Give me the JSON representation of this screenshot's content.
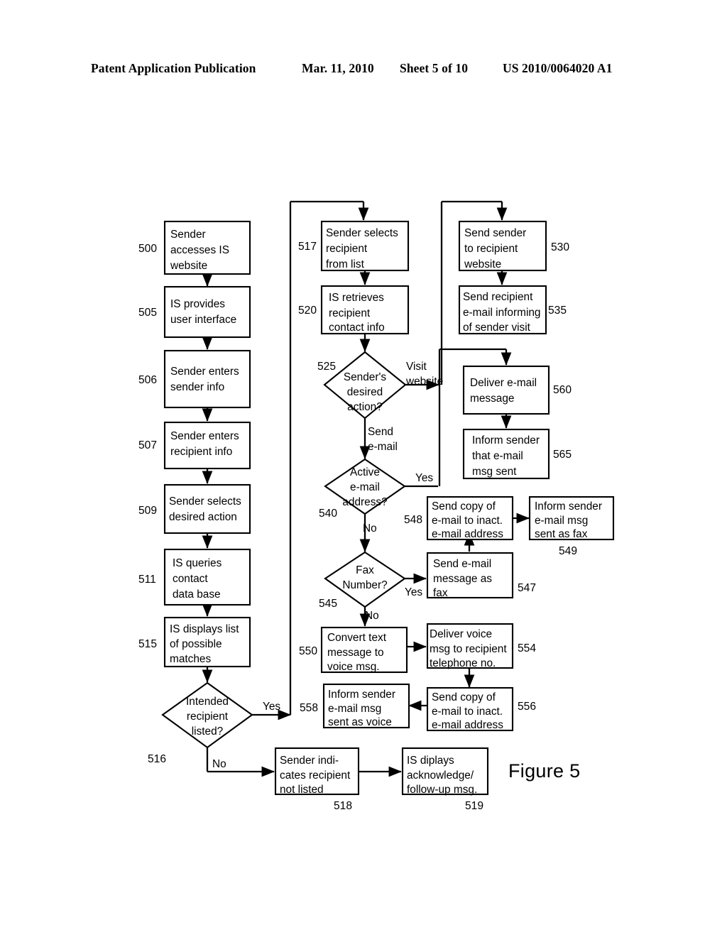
{
  "header": {
    "publication": "Patent Application Publication",
    "date": "Mar. 11, 2010",
    "sheet": "Sheet 5 of 10",
    "number": "US 2010/0064020 A1"
  },
  "figure": {
    "caption": "Figure 5"
  },
  "chart_data": {
    "type": "diagram",
    "title": "Figure 5",
    "diagram_kind": "flowchart",
    "nodes": [
      {
        "ref": "500",
        "shape": "process",
        "text": "Sender accesses IS website"
      },
      {
        "ref": "505",
        "shape": "process",
        "text": "IS provides user interface"
      },
      {
        "ref": "506",
        "shape": "process",
        "text": "Sender enters sender info"
      },
      {
        "ref": "507",
        "shape": "process",
        "text": "Sender enters recipient info"
      },
      {
        "ref": "509",
        "shape": "process",
        "text": "Sender selects desired action"
      },
      {
        "ref": "511",
        "shape": "process",
        "text": "IS queries contact data base"
      },
      {
        "ref": "515",
        "shape": "process",
        "text": "IS displays list of possible matches"
      },
      {
        "ref": "516",
        "shape": "decision",
        "text": "Intended recipient listed?"
      },
      {
        "ref": "517",
        "shape": "process",
        "text": "Sender selects recipient from list"
      },
      {
        "ref": "518",
        "shape": "process",
        "text": "Sender indicates recipient not listed"
      },
      {
        "ref": "519",
        "shape": "process",
        "text": "IS diplays acknowledge/ follow-up msg."
      },
      {
        "ref": "520",
        "shape": "process",
        "text": "IS retrieves recipient contact info"
      },
      {
        "ref": "525",
        "shape": "decision",
        "text": "Sender's desired action?"
      },
      {
        "ref": "530",
        "shape": "process",
        "text": "Send sender to recipient website"
      },
      {
        "ref": "535",
        "shape": "process",
        "text": "Send recipient e-mail informing of sender visit"
      },
      {
        "ref": "540",
        "shape": "decision",
        "text": "Active e-mail address?"
      },
      {
        "ref": "545",
        "shape": "decision",
        "text": "Fax Number?"
      },
      {
        "ref": "547",
        "shape": "process",
        "text": "Send e-mail message as fax"
      },
      {
        "ref": "548",
        "shape": "process",
        "text": "Send copy of e-mail to inact. e-mail address"
      },
      {
        "ref": "549",
        "shape": "process",
        "text": "Inform sender e-mail msg sent as fax"
      },
      {
        "ref": "550",
        "shape": "process",
        "text": "Convert text message to voice msg."
      },
      {
        "ref": "554",
        "shape": "process",
        "text": "Deliver voice msg to recipient telephone no."
      },
      {
        "ref": "556",
        "shape": "process",
        "text": "Send copy of e-mail to inact. e-mail address"
      },
      {
        "ref": "558",
        "shape": "process",
        "text": "Inform sender e-mail msg sent as voice"
      },
      {
        "ref": "560",
        "shape": "process",
        "text": "Deliver e-mail message"
      },
      {
        "ref": "565",
        "shape": "process",
        "text": "Inform sender that e-mail msg sent"
      }
    ],
    "edges": [
      {
        "from": "500",
        "to": "505",
        "label": ""
      },
      {
        "from": "505",
        "to": "506",
        "label": ""
      },
      {
        "from": "506",
        "to": "507",
        "label": ""
      },
      {
        "from": "507",
        "to": "509",
        "label": ""
      },
      {
        "from": "509",
        "to": "511",
        "label": ""
      },
      {
        "from": "511",
        "to": "515",
        "label": ""
      },
      {
        "from": "515",
        "to": "516",
        "label": ""
      },
      {
        "from": "516",
        "to": "517",
        "label": "Yes"
      },
      {
        "from": "516",
        "to": "518",
        "label": "No"
      },
      {
        "from": "518",
        "to": "519",
        "label": ""
      },
      {
        "from": "517",
        "to": "520",
        "label": ""
      },
      {
        "from": "520",
        "to": "525",
        "label": ""
      },
      {
        "from": "525",
        "to": "530",
        "label": "Visit website"
      },
      {
        "from": "525",
        "to": "540",
        "label": "Send e-mail"
      },
      {
        "from": "530",
        "to": "535",
        "label": ""
      },
      {
        "from": "540",
        "to": "560",
        "label": "Yes"
      },
      {
        "from": "540",
        "to": "545",
        "label": "No"
      },
      {
        "from": "545",
        "to": "547",
        "label": "Yes"
      },
      {
        "from": "545",
        "to": "550",
        "label": "No"
      },
      {
        "from": "547",
        "to": "548",
        "label": ""
      },
      {
        "from": "548",
        "to": "549",
        "label": ""
      },
      {
        "from": "550",
        "to": "554",
        "label": ""
      },
      {
        "from": "554",
        "to": "556",
        "label": ""
      },
      {
        "from": "556",
        "to": "558",
        "label": ""
      },
      {
        "from": "560",
        "to": "565",
        "label": ""
      }
    ]
  },
  "nodes": {
    "n500": {
      "ref": "500",
      "l1": "Sender",
      "l2": "accesses IS",
      "l3": "website"
    },
    "n505": {
      "ref": "505",
      "l1": "IS provides",
      "l2": "user interface",
      "l3": ""
    },
    "n506": {
      "ref": "506",
      "l1": "Sender enters",
      "l2": "sender info",
      "l3": ""
    },
    "n507": {
      "ref": "507",
      "l1": "Sender enters",
      "l2": "recipient info",
      "l3": ""
    },
    "n509": {
      "ref": "509",
      "l1": "Sender selects",
      "l2": "desired action",
      "l3": ""
    },
    "n511": {
      "ref": "511",
      "l1": "IS queries",
      "l2": "contact",
      "l3": "data base"
    },
    "n515": {
      "ref": "515",
      "l1": "IS displays list",
      "l2": "of possible",
      "l3": "matches"
    },
    "n516": {
      "ref": "516",
      "l1": "Intended",
      "l2": "recipient",
      "l3": "listed?"
    },
    "n517": {
      "ref": "517",
      "l1": "Sender selects",
      "l2": "recipient",
      "l3": "from list"
    },
    "n518": {
      "ref": "518",
      "l1": "Sender indi-",
      "l2": "cates recipient",
      "l3": "not listed"
    },
    "n519": {
      "ref": "519",
      "l1": "IS diplays",
      "l2": "acknowledge/",
      "l3": "follow-up msg."
    },
    "n520": {
      "ref": "520",
      "l1": "IS retrieves",
      "l2": "recipient",
      "l3": "contact info"
    },
    "n525": {
      "ref": "525",
      "l1": "Sender's",
      "l2": "desired",
      "l3": "action?"
    },
    "n530": {
      "ref": "530",
      "l1": "Send sender",
      "l2": "to recipient",
      "l3": "website"
    },
    "n535": {
      "ref": "535",
      "l1": "Send recipient",
      "l2": "e-mail informing",
      "l3": "of sender visit"
    },
    "n540": {
      "ref": "540",
      "l1": "Active",
      "l2": "e-mail",
      "l3": "address?"
    },
    "n545": {
      "ref": "545",
      "l1": "Fax",
      "l2": "Number?",
      "l3": ""
    },
    "n547": {
      "ref": "547",
      "l1": "Send e-mail",
      "l2": "message as",
      "l3": "fax"
    },
    "n548": {
      "ref": "548",
      "l1": "Send copy of",
      "l2": "e-mail to inact.",
      "l3": "e-mail address"
    },
    "n549": {
      "ref": "549",
      "l1": "Inform sender",
      "l2": "e-mail msg",
      "l3": "sent as fax"
    },
    "n550": {
      "ref": "550",
      "l1": "Convert text",
      "l2": "message to",
      "l3": "voice msg."
    },
    "n554": {
      "ref": "554",
      "l1": "Deliver voice",
      "l2": "msg to recipient",
      "l3": "telephone no."
    },
    "n556": {
      "ref": "556",
      "l1": "Send copy of",
      "l2": "e-mail to inact.",
      "l3": "e-mail address"
    },
    "n558": {
      "ref": "558",
      "l1": "Inform sender",
      "l2": "e-mail msg",
      "l3": "sent as voice"
    },
    "n560": {
      "ref": "560",
      "l1": "Deliver e-mail",
      "l2": "message",
      "l3": ""
    },
    "n565": {
      "ref": "565",
      "l1": "Inform sender",
      "l2": "that e-mail",
      "l3": "msg sent"
    }
  },
  "edge_labels": {
    "e516_yes": "Yes",
    "e516_no": "No",
    "e525_visit_1": "Visit",
    "e525_visit_2": "website",
    "e525_send_1": "Send",
    "e525_send_2": "e-mail",
    "e540_yes": "Yes",
    "e540_no": "No",
    "e545_yes": "Yes",
    "e545_no": "No"
  }
}
